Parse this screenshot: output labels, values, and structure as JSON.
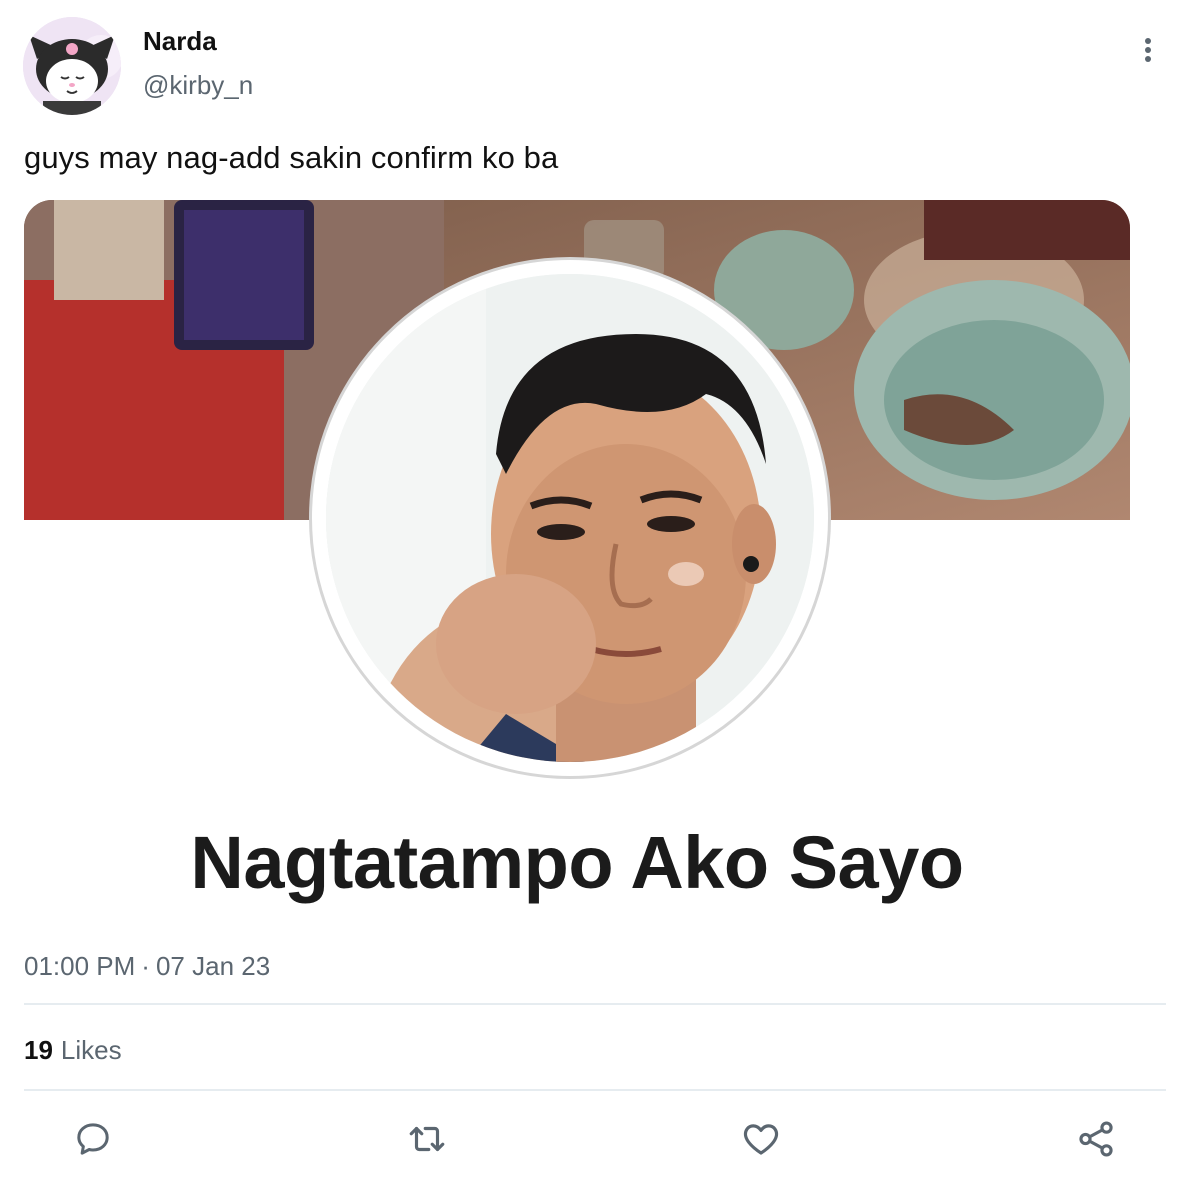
{
  "tweet": {
    "author": {
      "display_name": "Narda",
      "handle": "@kirby_n",
      "avatar_icon": "kuromi-avatar"
    },
    "text": "guys may nag-add sakin confirm ko ba",
    "media": {
      "profile_name": "Nagtatampo Ako Sayo"
    },
    "time": "01:00 PM",
    "separator": "·",
    "date": "07 Jan 23",
    "likes_count": "19",
    "likes_label": "Likes"
  },
  "actions": [
    {
      "name": "reply",
      "icon": "comment-icon"
    },
    {
      "name": "retweet",
      "icon": "retweet-icon"
    },
    {
      "name": "like",
      "icon": "heart-icon"
    },
    {
      "name": "share",
      "icon": "share-icon"
    }
  ],
  "colors": {
    "text": "#111111",
    "muted": "#5b6670",
    "divider": "#e6ecf0"
  }
}
